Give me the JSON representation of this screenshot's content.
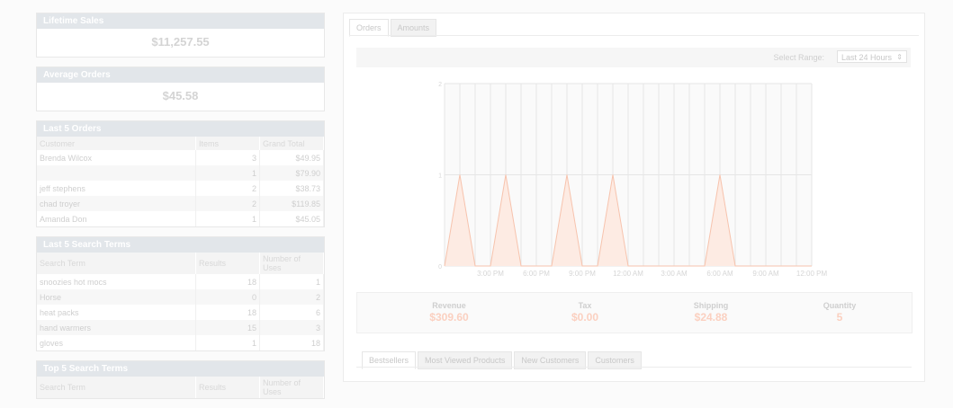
{
  "lifetime_sales": {
    "title": "Lifetime Sales",
    "value": "$11,257.55"
  },
  "average_orders": {
    "title": "Average Orders",
    "value": "$45.58"
  },
  "last_orders": {
    "title": "Last 5 Orders",
    "headers": [
      "Customer",
      "Items",
      "Grand Total"
    ],
    "rows": [
      {
        "customer": "Brenda Wilcox",
        "items": "3",
        "total": "$49.95"
      },
      {
        "customer": "",
        "items": "1",
        "total": "$79.90"
      },
      {
        "customer": "jeff stephens",
        "items": "2",
        "total": "$38.73"
      },
      {
        "customer": "chad troyer",
        "items": "2",
        "total": "$119.85"
      },
      {
        "customer": "Amanda Don",
        "items": "1",
        "total": "$45.05"
      }
    ]
  },
  "last_search": {
    "title": "Last 5 Search Terms",
    "headers": [
      "Search Term",
      "Results",
      "Number of Uses"
    ],
    "rows": [
      {
        "term": "snoozies hot mocs",
        "results": "18",
        "uses": "1"
      },
      {
        "term": "Horse",
        "results": "0",
        "uses": "2"
      },
      {
        "term": "heat packs",
        "results": "18",
        "uses": "6"
      },
      {
        "term": "hand warmers",
        "results": "15",
        "uses": "3"
      },
      {
        "term": "gloves",
        "results": "1",
        "uses": "18"
      }
    ]
  },
  "top_search": {
    "title": "Top 5 Search Terms",
    "headers": [
      "Search Term",
      "Results",
      "Number of Uses"
    ]
  },
  "tabs": {
    "orders": "Orders",
    "amounts": "Amounts"
  },
  "range": {
    "label": "Select Range:",
    "value": "Last 24 Hours"
  },
  "chart_data": {
    "type": "area",
    "x_ticks": [
      "3:00 PM",
      "6:00 PM",
      "9:00 PM",
      "12:00 AM",
      "3:00 AM",
      "6:00 AM",
      "9:00 AM",
      "12:00 PM"
    ],
    "y_ticks": [
      "0",
      "1",
      "2"
    ],
    "ylim": [
      0,
      2
    ],
    "x_hours": [
      0,
      1,
      2,
      3,
      4,
      5,
      6,
      7,
      8,
      9,
      10,
      11,
      12,
      13,
      14,
      15,
      16,
      17,
      18,
      19,
      20,
      21,
      22,
      23,
      24
    ],
    "series": [
      {
        "values": [
          0,
          1,
          0,
          0,
          1,
          0,
          0,
          0,
          1,
          0,
          0,
          1,
          0,
          0,
          0,
          0,
          0,
          0,
          1,
          0,
          0,
          0,
          0,
          0,
          0
        ]
      }
    ],
    "grid": true,
    "colors": {
      "fill": "#fdebe3",
      "line": "#f7c3ad",
      "grid": "#e6e6e6"
    }
  },
  "totals": [
    {
      "label": "Revenue",
      "value": "$309.60"
    },
    {
      "label": "Tax",
      "value": "$0.00"
    },
    {
      "label": "Shipping",
      "value": "$24.88"
    },
    {
      "label": "Quantity",
      "value": "5"
    }
  ],
  "bottom_tabs": [
    "Bestsellers",
    "Most Viewed Products",
    "New Customers",
    "Customers"
  ]
}
